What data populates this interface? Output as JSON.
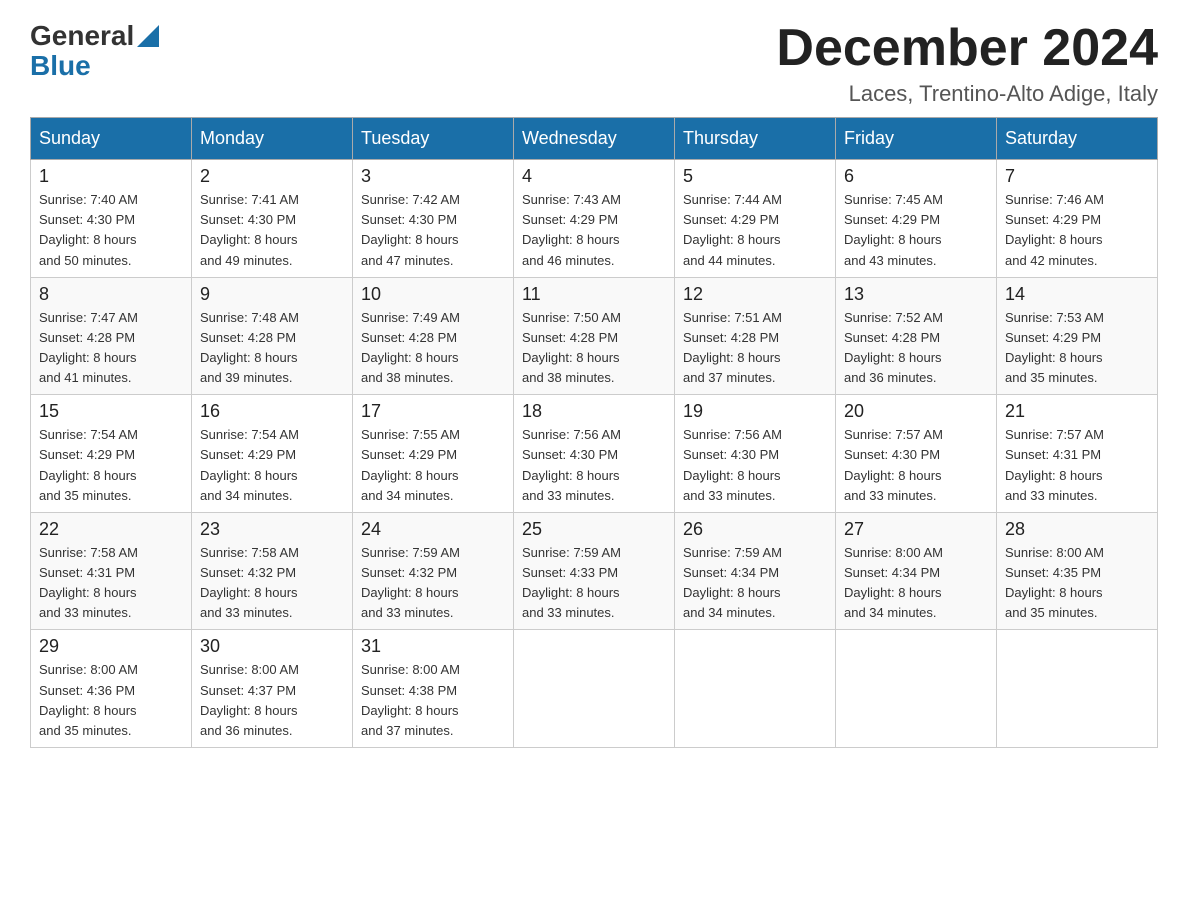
{
  "header": {
    "logo": {
      "general": "General",
      "blue": "Blue"
    },
    "title": "December 2024",
    "subtitle": "Laces, Trentino-Alto Adige, Italy"
  },
  "calendar": {
    "days_of_week": [
      "Sunday",
      "Monday",
      "Tuesday",
      "Wednesday",
      "Thursday",
      "Friday",
      "Saturday"
    ],
    "weeks": [
      [
        {
          "day": "1",
          "sunrise": "7:40 AM",
          "sunset": "4:30 PM",
          "daylight": "8 hours and 50 minutes."
        },
        {
          "day": "2",
          "sunrise": "7:41 AM",
          "sunset": "4:30 PM",
          "daylight": "8 hours and 49 minutes."
        },
        {
          "day": "3",
          "sunrise": "7:42 AM",
          "sunset": "4:30 PM",
          "daylight": "8 hours and 47 minutes."
        },
        {
          "day": "4",
          "sunrise": "7:43 AM",
          "sunset": "4:29 PM",
          "daylight": "8 hours and 46 minutes."
        },
        {
          "day": "5",
          "sunrise": "7:44 AM",
          "sunset": "4:29 PM",
          "daylight": "8 hours and 44 minutes."
        },
        {
          "day": "6",
          "sunrise": "7:45 AM",
          "sunset": "4:29 PM",
          "daylight": "8 hours and 43 minutes."
        },
        {
          "day": "7",
          "sunrise": "7:46 AM",
          "sunset": "4:29 PM",
          "daylight": "8 hours and 42 minutes."
        }
      ],
      [
        {
          "day": "8",
          "sunrise": "7:47 AM",
          "sunset": "4:28 PM",
          "daylight": "8 hours and 41 minutes."
        },
        {
          "day": "9",
          "sunrise": "7:48 AM",
          "sunset": "4:28 PM",
          "daylight": "8 hours and 39 minutes."
        },
        {
          "day": "10",
          "sunrise": "7:49 AM",
          "sunset": "4:28 PM",
          "daylight": "8 hours and 38 minutes."
        },
        {
          "day": "11",
          "sunrise": "7:50 AM",
          "sunset": "4:28 PM",
          "daylight": "8 hours and 38 minutes."
        },
        {
          "day": "12",
          "sunrise": "7:51 AM",
          "sunset": "4:28 PM",
          "daylight": "8 hours and 37 minutes."
        },
        {
          "day": "13",
          "sunrise": "7:52 AM",
          "sunset": "4:28 PM",
          "daylight": "8 hours and 36 minutes."
        },
        {
          "day": "14",
          "sunrise": "7:53 AM",
          "sunset": "4:29 PM",
          "daylight": "8 hours and 35 minutes."
        }
      ],
      [
        {
          "day": "15",
          "sunrise": "7:54 AM",
          "sunset": "4:29 PM",
          "daylight": "8 hours and 35 minutes."
        },
        {
          "day": "16",
          "sunrise": "7:54 AM",
          "sunset": "4:29 PM",
          "daylight": "8 hours and 34 minutes."
        },
        {
          "day": "17",
          "sunrise": "7:55 AM",
          "sunset": "4:29 PM",
          "daylight": "8 hours and 34 minutes."
        },
        {
          "day": "18",
          "sunrise": "7:56 AM",
          "sunset": "4:30 PM",
          "daylight": "8 hours and 33 minutes."
        },
        {
          "day": "19",
          "sunrise": "7:56 AM",
          "sunset": "4:30 PM",
          "daylight": "8 hours and 33 minutes."
        },
        {
          "day": "20",
          "sunrise": "7:57 AM",
          "sunset": "4:30 PM",
          "daylight": "8 hours and 33 minutes."
        },
        {
          "day": "21",
          "sunrise": "7:57 AM",
          "sunset": "4:31 PM",
          "daylight": "8 hours and 33 minutes."
        }
      ],
      [
        {
          "day": "22",
          "sunrise": "7:58 AM",
          "sunset": "4:31 PM",
          "daylight": "8 hours and 33 minutes."
        },
        {
          "day": "23",
          "sunrise": "7:58 AM",
          "sunset": "4:32 PM",
          "daylight": "8 hours and 33 minutes."
        },
        {
          "day": "24",
          "sunrise": "7:59 AM",
          "sunset": "4:32 PM",
          "daylight": "8 hours and 33 minutes."
        },
        {
          "day": "25",
          "sunrise": "7:59 AM",
          "sunset": "4:33 PM",
          "daylight": "8 hours and 33 minutes."
        },
        {
          "day": "26",
          "sunrise": "7:59 AM",
          "sunset": "4:34 PM",
          "daylight": "8 hours and 34 minutes."
        },
        {
          "day": "27",
          "sunrise": "8:00 AM",
          "sunset": "4:34 PM",
          "daylight": "8 hours and 34 minutes."
        },
        {
          "day": "28",
          "sunrise": "8:00 AM",
          "sunset": "4:35 PM",
          "daylight": "8 hours and 35 minutes."
        }
      ],
      [
        {
          "day": "29",
          "sunrise": "8:00 AM",
          "sunset": "4:36 PM",
          "daylight": "8 hours and 35 minutes."
        },
        {
          "day": "30",
          "sunrise": "8:00 AM",
          "sunset": "4:37 PM",
          "daylight": "8 hours and 36 minutes."
        },
        {
          "day": "31",
          "sunrise": "8:00 AM",
          "sunset": "4:38 PM",
          "daylight": "8 hours and 37 minutes."
        },
        null,
        null,
        null,
        null
      ]
    ],
    "labels": {
      "sunrise": "Sunrise:",
      "sunset": "Sunset:",
      "daylight": "Daylight:"
    }
  }
}
